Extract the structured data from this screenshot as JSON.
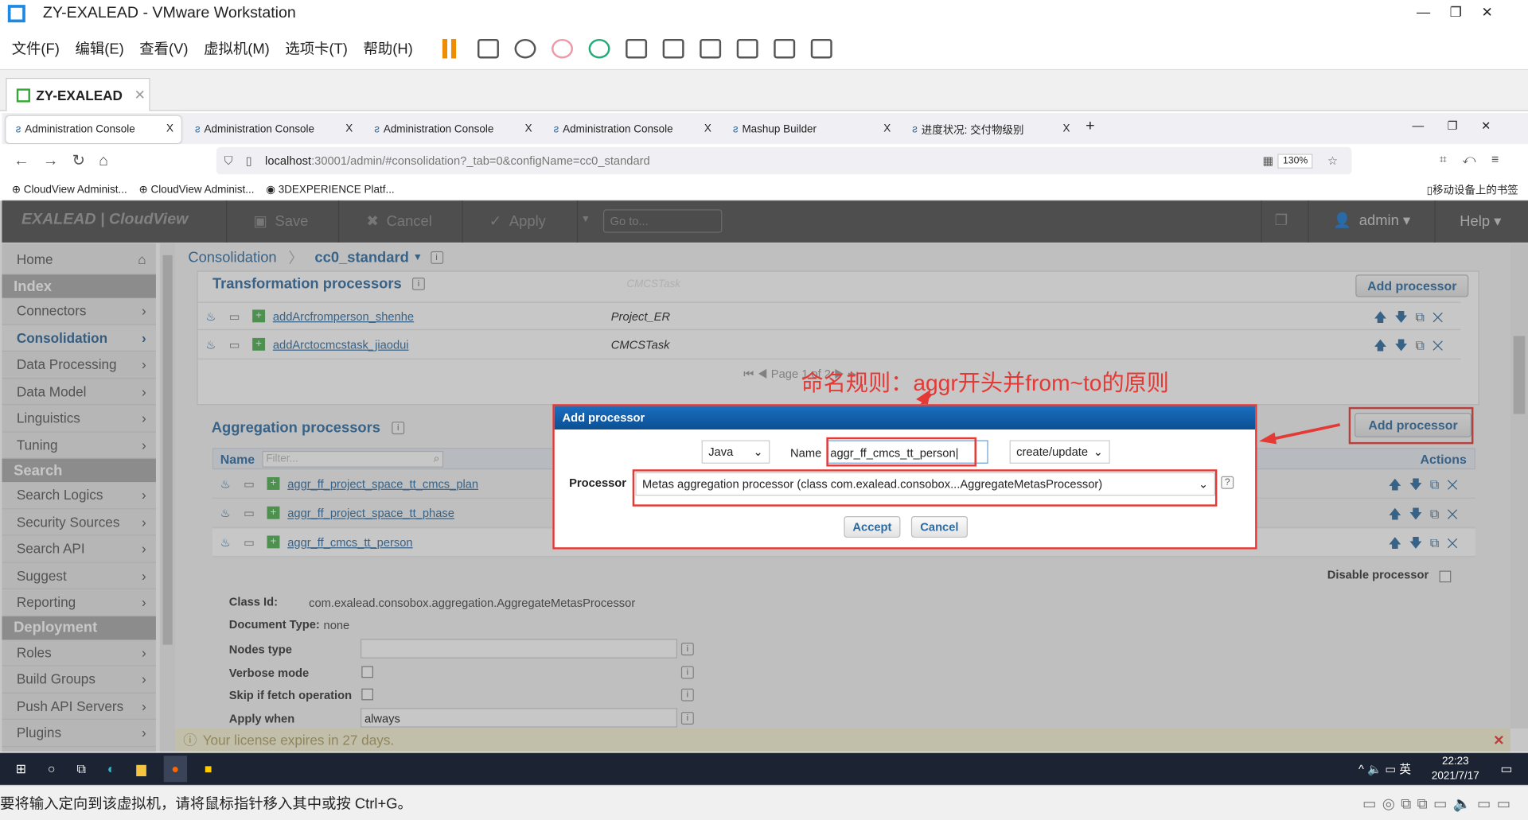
{
  "window": {
    "title": "ZY-EXALEAD - VMware Workstation",
    "min": "—",
    "max": "❐",
    "close": "✕"
  },
  "menu": [
    "文件(F)",
    "编辑(E)",
    "查看(V)",
    "虚拟机(M)",
    "选项卡(T)",
    "帮助(H)"
  ],
  "vm_tab": {
    "label": "ZY-EXALEAD",
    "close": "✕"
  },
  "browser": {
    "tabs": [
      {
        "label": "Administration Console"
      },
      {
        "label": "Administration Console"
      },
      {
        "label": "Administration Console"
      },
      {
        "label": "Administration Console"
      },
      {
        "label": "Mashup Builder"
      },
      {
        "label": "进度状况: 交付物级别"
      }
    ],
    "tab_close": "X",
    "new_tab": "+",
    "url_host": "localhost",
    "url_rest": ":30001/admin/#consolidation?_tab=0&configName=cc0_standard",
    "zoom": "130%",
    "bookmarks": [
      "CloudView Administ...",
      "CloudView Administ...",
      "3DEXPERIENCE Platf..."
    ],
    "mobile_bookmarks": "移动设备上的书签"
  },
  "app": {
    "logo": "EXALEAD | CloudView",
    "save": "Save",
    "cancel": "Cancel",
    "apply": "Apply",
    "goto_placeholder": "Go to...",
    "user": "admin",
    "help": "Help"
  },
  "sidebar": {
    "home": "Home",
    "sections": [
      {
        "title": "Index",
        "items": [
          "Connectors",
          "Consolidation",
          "Data Processing",
          "Data Model",
          "Linguistics",
          "Tuning"
        ]
      },
      {
        "title": "Search",
        "items": [
          "Search Logics",
          "Security Sources",
          "Search API",
          "Suggest",
          "Reporting"
        ]
      },
      {
        "title": "Deployment",
        "items": [
          "Roles",
          "Build Groups",
          "Push API Servers",
          "Plugins"
        ]
      }
    ],
    "active": "Consolidation"
  },
  "breadcrumb": {
    "root": "Consolidation",
    "current": "cc0_standard"
  },
  "transformation": {
    "title": "Transformation processors",
    "faded": "CMCSTask",
    "add": "Add processor",
    "rows": [
      {
        "name": "addArcfromperson_shenhe",
        "type": "Project_ER"
      },
      {
        "name": "addArctocmcstask_jiaodui",
        "type": "CMCSTask"
      }
    ],
    "pager": "Page 1 of 2"
  },
  "aggregation": {
    "title": "Aggregation processors",
    "add": "Add processor",
    "col_name": "Name",
    "filter_placeholder": "Filter...",
    "col_actions": "Actions",
    "rows": [
      {
        "name": "aggr_ff_project_space_tt_cmcs_plan"
      },
      {
        "name": "aggr_ff_project_space_tt_phase"
      },
      {
        "name": "aggr_ff_cmcs_tt_person"
      }
    ]
  },
  "details": {
    "disable": "Disable processor",
    "class_id_label": "Class Id:",
    "class_id": "com.exalead.consobox.aggregation.AggregateMetasProcessor",
    "doc_type_label": "Document Type:",
    "doc_type": "none",
    "nodes_type": "Nodes type",
    "verbose": "Verbose mode",
    "skip": "Skip if fetch operation",
    "apply_when": "Apply when",
    "apply_when_value": "always"
  },
  "dialog": {
    "title": "Add processor",
    "lang": "Java",
    "name_label": "Name",
    "name_value": "aggr_ff_cmcs_tt_person",
    "mode": "create/update",
    "processor_label": "Processor",
    "processor_value": "Metas aggregation processor (class com.exalead.consobox...AggregateMetasProcessor)",
    "help": "?",
    "accept": "Accept",
    "cancel": "Cancel"
  },
  "annotation": "命名规则：aggr开头并from~to的原则",
  "license": "Your license expires in 27 days.",
  "taskbar": {
    "time": "22:23",
    "date": "2021/7/17",
    "ime": "英"
  },
  "status": "要将输入定向到该虚拟机，请将鼠标指针移入其中或按 Ctrl+G。",
  "colors": {
    "accent": "#2d6aa0",
    "header": "#4d4d4d",
    "dialog_header": "#0b4f93",
    "annotation": "#e53935"
  }
}
